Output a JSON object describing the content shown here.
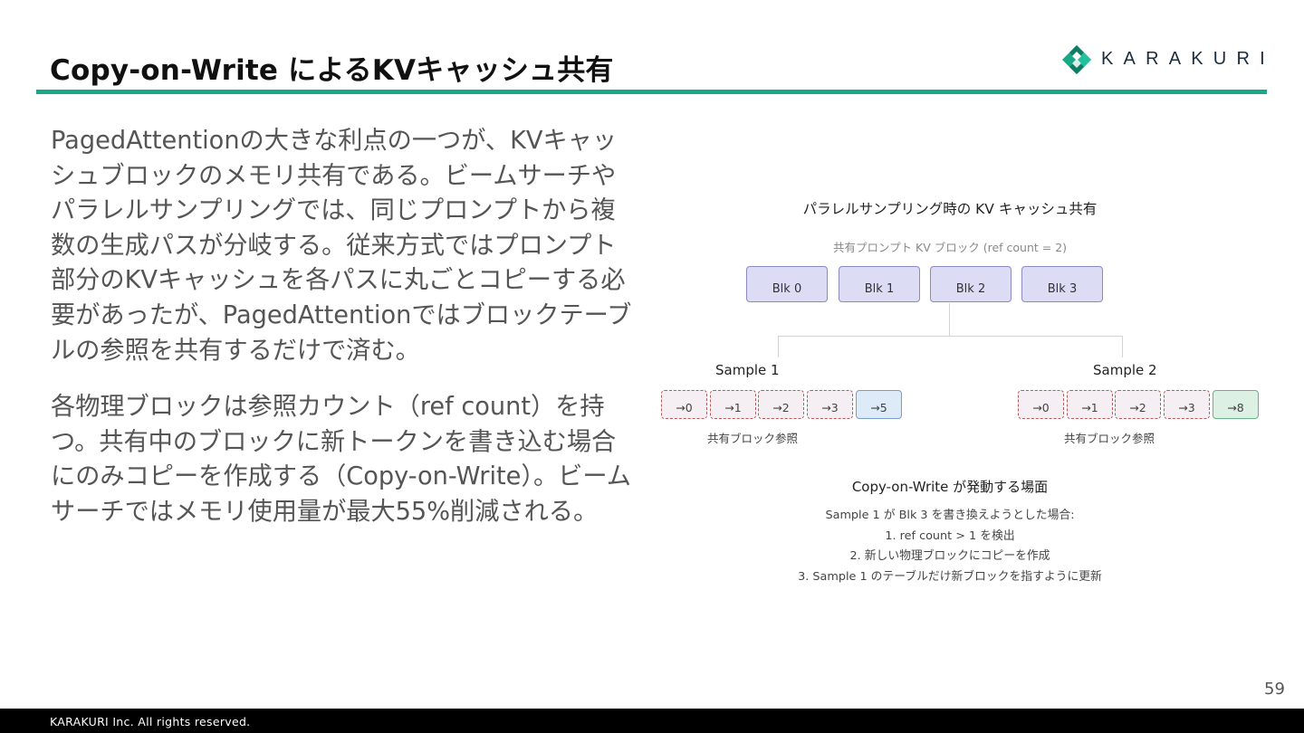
{
  "slide": {
    "title": "Copy-on-Write によるKVキャッシュ共有",
    "page_number": "59",
    "footer": "KARAKURI Inc.   All rights reserved."
  },
  "logo": {
    "text": "KARAKURI"
  },
  "body": {
    "paragraphs": [
      "PagedAttentionの大きな利点の一つが、KVキャッシュブロックのメモリ共有である。ビームサーチやパラレルサンプリングでは、同じプロンプトから複数の生成パスが分岐する。従来方式ではプロンプト部分のKVキャッシュを各パスに丸ごとコピーする必要があったが、PagedAttentionではブロックテーブルの参照を共有するだけで済む。",
      "各物理ブロックは参照カウント（ref count）を持つ。共有中のブロックに新トークンを書き込む場合にのみコピーを作成する（Copy-on-Write）。ビームサーチではメモリ使用量が最大55%削減される。"
    ]
  },
  "diagram": {
    "title": "パラレルサンプリング時の KV キャッシュ共有",
    "subtitle": "共有プロンプト KV ブロック (ref count = 2)",
    "blocks": [
      "Blk 0",
      "Blk 1",
      "Blk 2",
      "Blk 3"
    ],
    "samples": [
      {
        "label": "Sample 1",
        "cells": [
          "→0",
          "→1",
          "→2",
          "→3",
          "→5"
        ],
        "note": "共有ブロック参照"
      },
      {
        "label": "Sample 2",
        "cells": [
          "→0",
          "→1",
          "→2",
          "→3",
          "→8"
        ],
        "note": "共有ブロック参照"
      }
    ],
    "cow": {
      "title": "Copy-on-Write が発動する場面",
      "lines": [
        "Sample 1 が Blk 3 を書き換えようとした場合:",
        "1. ref count > 1 を検出",
        "2. 新しい物理ブロックにコピーを作成",
        "3. Sample 1 のテーブルだけ新ブロックを指すように更新"
      ]
    }
  },
  "colors": {
    "accent": "#18a888",
    "shared_block_fill": "#dcdcf5",
    "shared_ref_border": "#b85a5a",
    "sample1_new_block": "#ddeaf7",
    "sample2_new_block": "#dcf0e3"
  }
}
